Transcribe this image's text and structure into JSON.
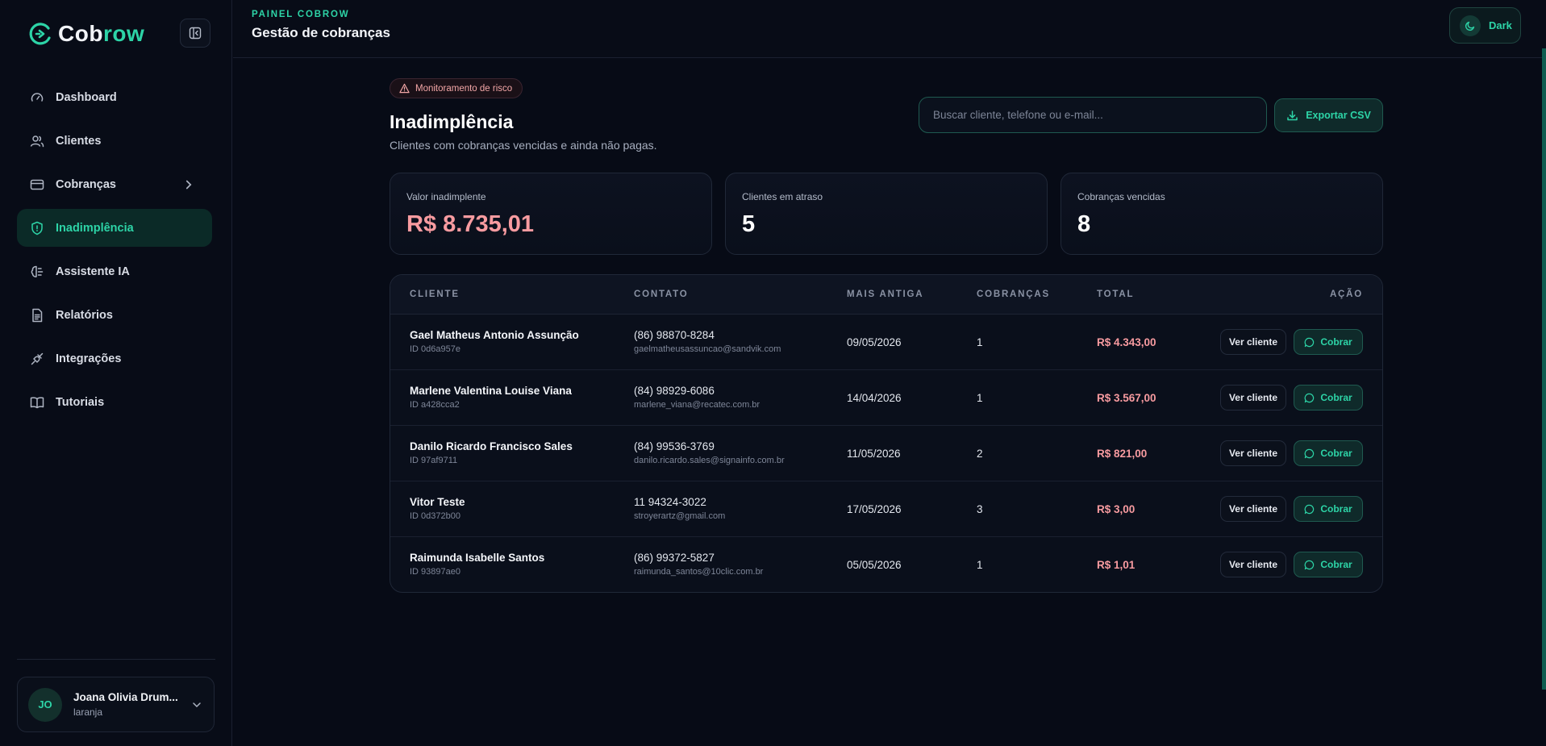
{
  "brand": {
    "part1": "Cob",
    "part2": "row"
  },
  "header": {
    "kicker": "PAINEL COBROW",
    "title": "Gestão de cobranças",
    "theme_label": "Dark"
  },
  "sidebar": {
    "items": [
      {
        "label": "Dashboard"
      },
      {
        "label": "Clientes"
      },
      {
        "label": "Cobranças"
      },
      {
        "label": "Inadimplência"
      },
      {
        "label": "Assistente IA"
      },
      {
        "label": "Relatórios"
      },
      {
        "label": "Integrações"
      },
      {
        "label": "Tutoriais"
      }
    ],
    "user": {
      "initials": "JO",
      "name": "Joana Olivia Drum...",
      "sub": "laranja"
    }
  },
  "main": {
    "badge": "Monitoramento de risco",
    "title": "Inadimplência",
    "subtitle": "Clientes com cobranças vencidas e ainda não pagas.",
    "search_placeholder": "Buscar cliente, telefone ou e-mail...",
    "export_label": "Exportar CSV",
    "stats": [
      {
        "label": "Valor inadimplente",
        "value": "R$ 8.735,01"
      },
      {
        "label": "Clientes em atraso",
        "value": "5"
      },
      {
        "label": "Cobranças vencidas",
        "value": "8"
      }
    ],
    "table": {
      "headers": [
        "CLIENTE",
        "CONTATO",
        "MAIS ANTIGA",
        "COBRANÇAS",
        "TOTAL",
        "AÇÃO"
      ],
      "view_label": "Ver cliente",
      "charge_label": "Cobrar",
      "rows": [
        {
          "name": "Gael Matheus Antonio Assunção",
          "id": "ID 0d6a957e",
          "phone": "(86) 98870-8284",
          "email": "gaelmatheusassuncao@sandvik.com",
          "date": "09/05/2026",
          "count": "1",
          "total": "R$ 4.343,00"
        },
        {
          "name": "Marlene Valentina Louise Viana",
          "id": "ID a428cca2",
          "phone": "(84) 98929-6086",
          "email": "marlene_viana@recatec.com.br",
          "date": "14/04/2026",
          "count": "1",
          "total": "R$ 3.567,00"
        },
        {
          "name": "Danilo Ricardo Francisco Sales",
          "id": "ID 97af9711",
          "phone": "(84) 99536-3769",
          "email": "danilo.ricardo.sales@signainfo.com.br",
          "date": "11/05/2026",
          "count": "2",
          "total": "R$ 821,00"
        },
        {
          "name": "Vitor Teste",
          "id": "ID 0d372b00",
          "phone": "11 94324-3022",
          "email": "stroyerartz@gmail.com",
          "date": "17/05/2026",
          "count": "3",
          "total": "R$ 3,00"
        },
        {
          "name": "Raimunda Isabelle Santos",
          "id": "ID 93897ae0",
          "phone": "(86) 99372-5827",
          "email": "raimunda_santos@10clic.com.br",
          "date": "05/05/2026",
          "count": "1",
          "total": "R$ 1,01"
        }
      ]
    }
  },
  "colors": {
    "accent": "#2dd4a7",
    "danger": "#f89ba0",
    "background": "#070b16"
  }
}
